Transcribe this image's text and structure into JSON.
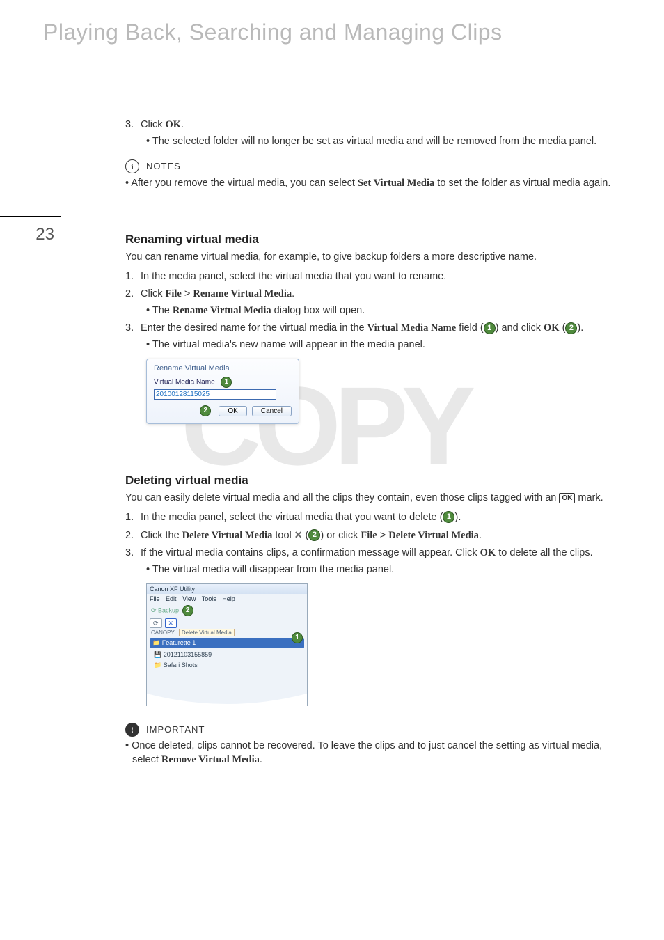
{
  "page_number": "23",
  "chapter_title": "Playing Back, Searching and Managing Clips",
  "watermark": "COPY",
  "blockA": {
    "step3_num": "3.",
    "step3_text_a": "Click ",
    "step3_text_b": "OK",
    "step3_text_c": ".",
    "step3_sub": "The selected folder will no longer be set as virtual media and will be removed from the media panel."
  },
  "notes": {
    "label": "NOTES",
    "icon": "i",
    "bullet_a": "After you remove the virtual media, you can select ",
    "bullet_b": "Set Virtual Media",
    "bullet_c": " to set the folder as virtual media again."
  },
  "renaming": {
    "heading": "Renaming virtual media",
    "intro": "You can rename virtual media, for example, to give backup folders a more descriptive name.",
    "s1_num": "1.",
    "s1": "In the media panel, select the virtual media that you want to rename.",
    "s2_num": "2.",
    "s2_a": "Click ",
    "s2_b": "File",
    "s2_c": " > ",
    "s2_d": "Rename Virtual Media",
    "s2_e": ".",
    "s2_sub_a": "The ",
    "s2_sub_b": "Rename Virtual Media",
    "s2_sub_c": " dialog box will open.",
    "s3_num": "3.",
    "s3_a": "Enter the desired name for the virtual media in the ",
    "s3_b": "Virtual Media Name",
    "s3_c": " field (",
    "s3_d": ") and click ",
    "s3_e": "OK",
    "s3_f": " (",
    "s3_g": ").",
    "s3_sub": "The virtual media's new name will appear in the media panel.",
    "callout1": "1",
    "callout2": "2",
    "dialog": {
      "title": "Rename Virtual Media",
      "label": "Virtual Media Name",
      "value": "20100128115025",
      "ok": "OK",
      "cancel": "Cancel"
    }
  },
  "deleting": {
    "heading": "Deleting virtual media",
    "intro_a": "You can easily delete virtual media and all the clips they contain, even those clips tagged with an ",
    "intro_b": " mark.",
    "ok_mark": "OK",
    "s1_num": "1.",
    "s1_a": "In the media panel, select the virtual media that you want to delete (",
    "s1_b": ").",
    "c1": "1",
    "s2_num": "2.",
    "s2_a": "Click the ",
    "s2_b": "Delete Virtual Media",
    "s2_c": " tool ",
    "s2_d": " (",
    "s2_e": ") or click ",
    "s2_f": "File",
    "s2_g": " > ",
    "s2_h": "Delete Virtual Media",
    "s2_i": ".",
    "c2": "2",
    "s3_num": "3.",
    "s3_a": "If the virtual media contains clips, a confirmation message will appear. Click ",
    "s3_b": "OK",
    "s3_c": " to delete all the clips.",
    "s3_sub": "The virtual media will disappear from the media panel.",
    "appwin": {
      "title": "Canon XF Utility",
      "menu": {
        "file": "File",
        "edit": "Edit",
        "view": "View",
        "tools": "Tools",
        "help": "Help"
      },
      "backup": "Backup",
      "canopy": "CANOPY",
      "tooltip": "Delete Virtual Media",
      "sel": "Featurette 1",
      "row1": "20121103155859",
      "row2": "Safari Shots"
    }
  },
  "important": {
    "label": "IMPORTANT",
    "icon": "!",
    "bullet_a": "Once deleted, clips cannot be recovered. To leave the clips and to just cancel the setting as virtual media, select ",
    "bullet_b": "Remove Virtual Media",
    "bullet_c": "."
  }
}
